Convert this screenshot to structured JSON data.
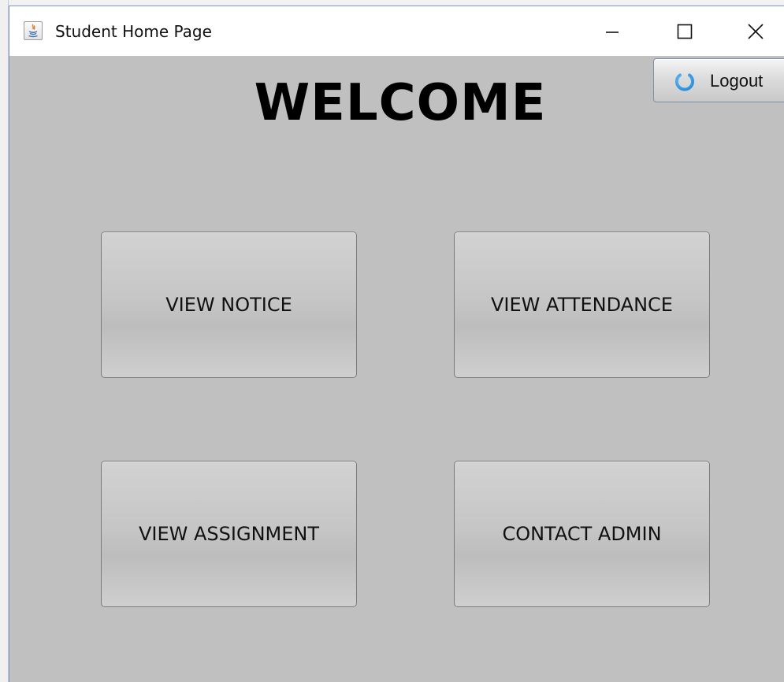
{
  "window": {
    "title": "Student Home Page",
    "icon": "java-app-icon",
    "controls": {
      "minimize_icon": "minimize-icon",
      "maximize_icon": "maximize-icon",
      "close_icon": "close-icon"
    }
  },
  "header": {
    "welcome_text": "WELCOME",
    "logout": {
      "label": "Logout",
      "icon": "power-icon",
      "icon_color": "#3aa0e8"
    }
  },
  "main": {
    "buttons": [
      {
        "label": "VIEW NOTICE"
      },
      {
        "label": "VIEW ATTENDANCE"
      },
      {
        "label": "VIEW ASSIGNMENT"
      },
      {
        "label": "CONTACT ADMIN"
      }
    ]
  },
  "colors": {
    "background": "#c0c0c0",
    "titlebar": "#ffffff",
    "text": "#000000"
  }
}
